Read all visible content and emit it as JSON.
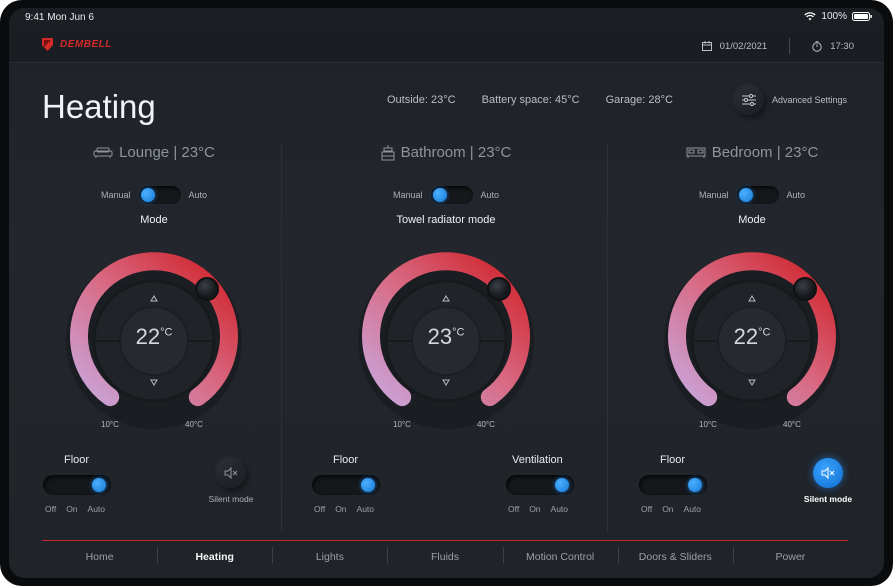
{
  "status_bar": {
    "time": "9:41 Mon Jun 6",
    "battery": "100%"
  },
  "header": {
    "brand": "DEMBELL",
    "date": "01/02/2021",
    "clock": "17:30"
  },
  "page": {
    "title": "Heating"
  },
  "stats": {
    "outside": "Outside: 23°C",
    "battery_space": "Battery space: 45°C",
    "garage": "Garage: 28°C"
  },
  "advanced": {
    "label": "Advanced Settings"
  },
  "zones": [
    {
      "name": "Lounge | 23°C",
      "manual": "Manual",
      "auto": "Auto",
      "mode_label": "Mode",
      "temp": "22",
      "unit": "°C",
      "min": "10°C",
      "max": "40°C",
      "floor": "Floor",
      "off": "Off",
      "on": "On",
      "auto_opt": "Auto",
      "silent": "Silent mode",
      "silent_active": false,
      "toggle_state": "auto",
      "floor_state": "auto"
    },
    {
      "name": "Bathroom | 23°C",
      "manual": "Manual",
      "auto": "Auto",
      "mode_label": "Towel radiator mode",
      "temp": "23",
      "unit": "°C",
      "min": "10°C",
      "max": "40°C",
      "floor": "Floor",
      "ventilation": "Ventilation",
      "off": "Off",
      "on": "On",
      "auto_opt": "Auto",
      "toggle_state": "auto",
      "floor_state": "auto",
      "ventilation_state": "auto"
    },
    {
      "name": "Bedroom | 23°C",
      "manual": "Manual",
      "auto": "Auto",
      "mode_label": "Mode",
      "temp": "22",
      "unit": "°C",
      "min": "10°C",
      "max": "40°C",
      "floor": "Floor",
      "off": "Off",
      "on": "On",
      "auto_opt": "Auto",
      "silent": "Silent mode",
      "silent_active": true,
      "toggle_state": "auto",
      "floor_state": "auto"
    }
  ],
  "nav": {
    "items": [
      "Home",
      "Heating",
      "Lights",
      "Fluids",
      "Motion Control",
      "Doors & Sliders",
      "Power"
    ],
    "active": "Heating"
  },
  "colors": {
    "accent_blue": "#1e8cff",
    "brand_red": "#d52a2a",
    "arc_start": "#c9a6dc",
    "arc_end": "#d01f25"
  },
  "icons": {
    "calendar": "calendar-icon",
    "timer": "stopwatch-icon",
    "sofa": "sofa-icon",
    "bath": "shower-icon",
    "bed": "bed-icon",
    "sliders": "sliders-icon",
    "mute": "speaker-mute-icon"
  }
}
